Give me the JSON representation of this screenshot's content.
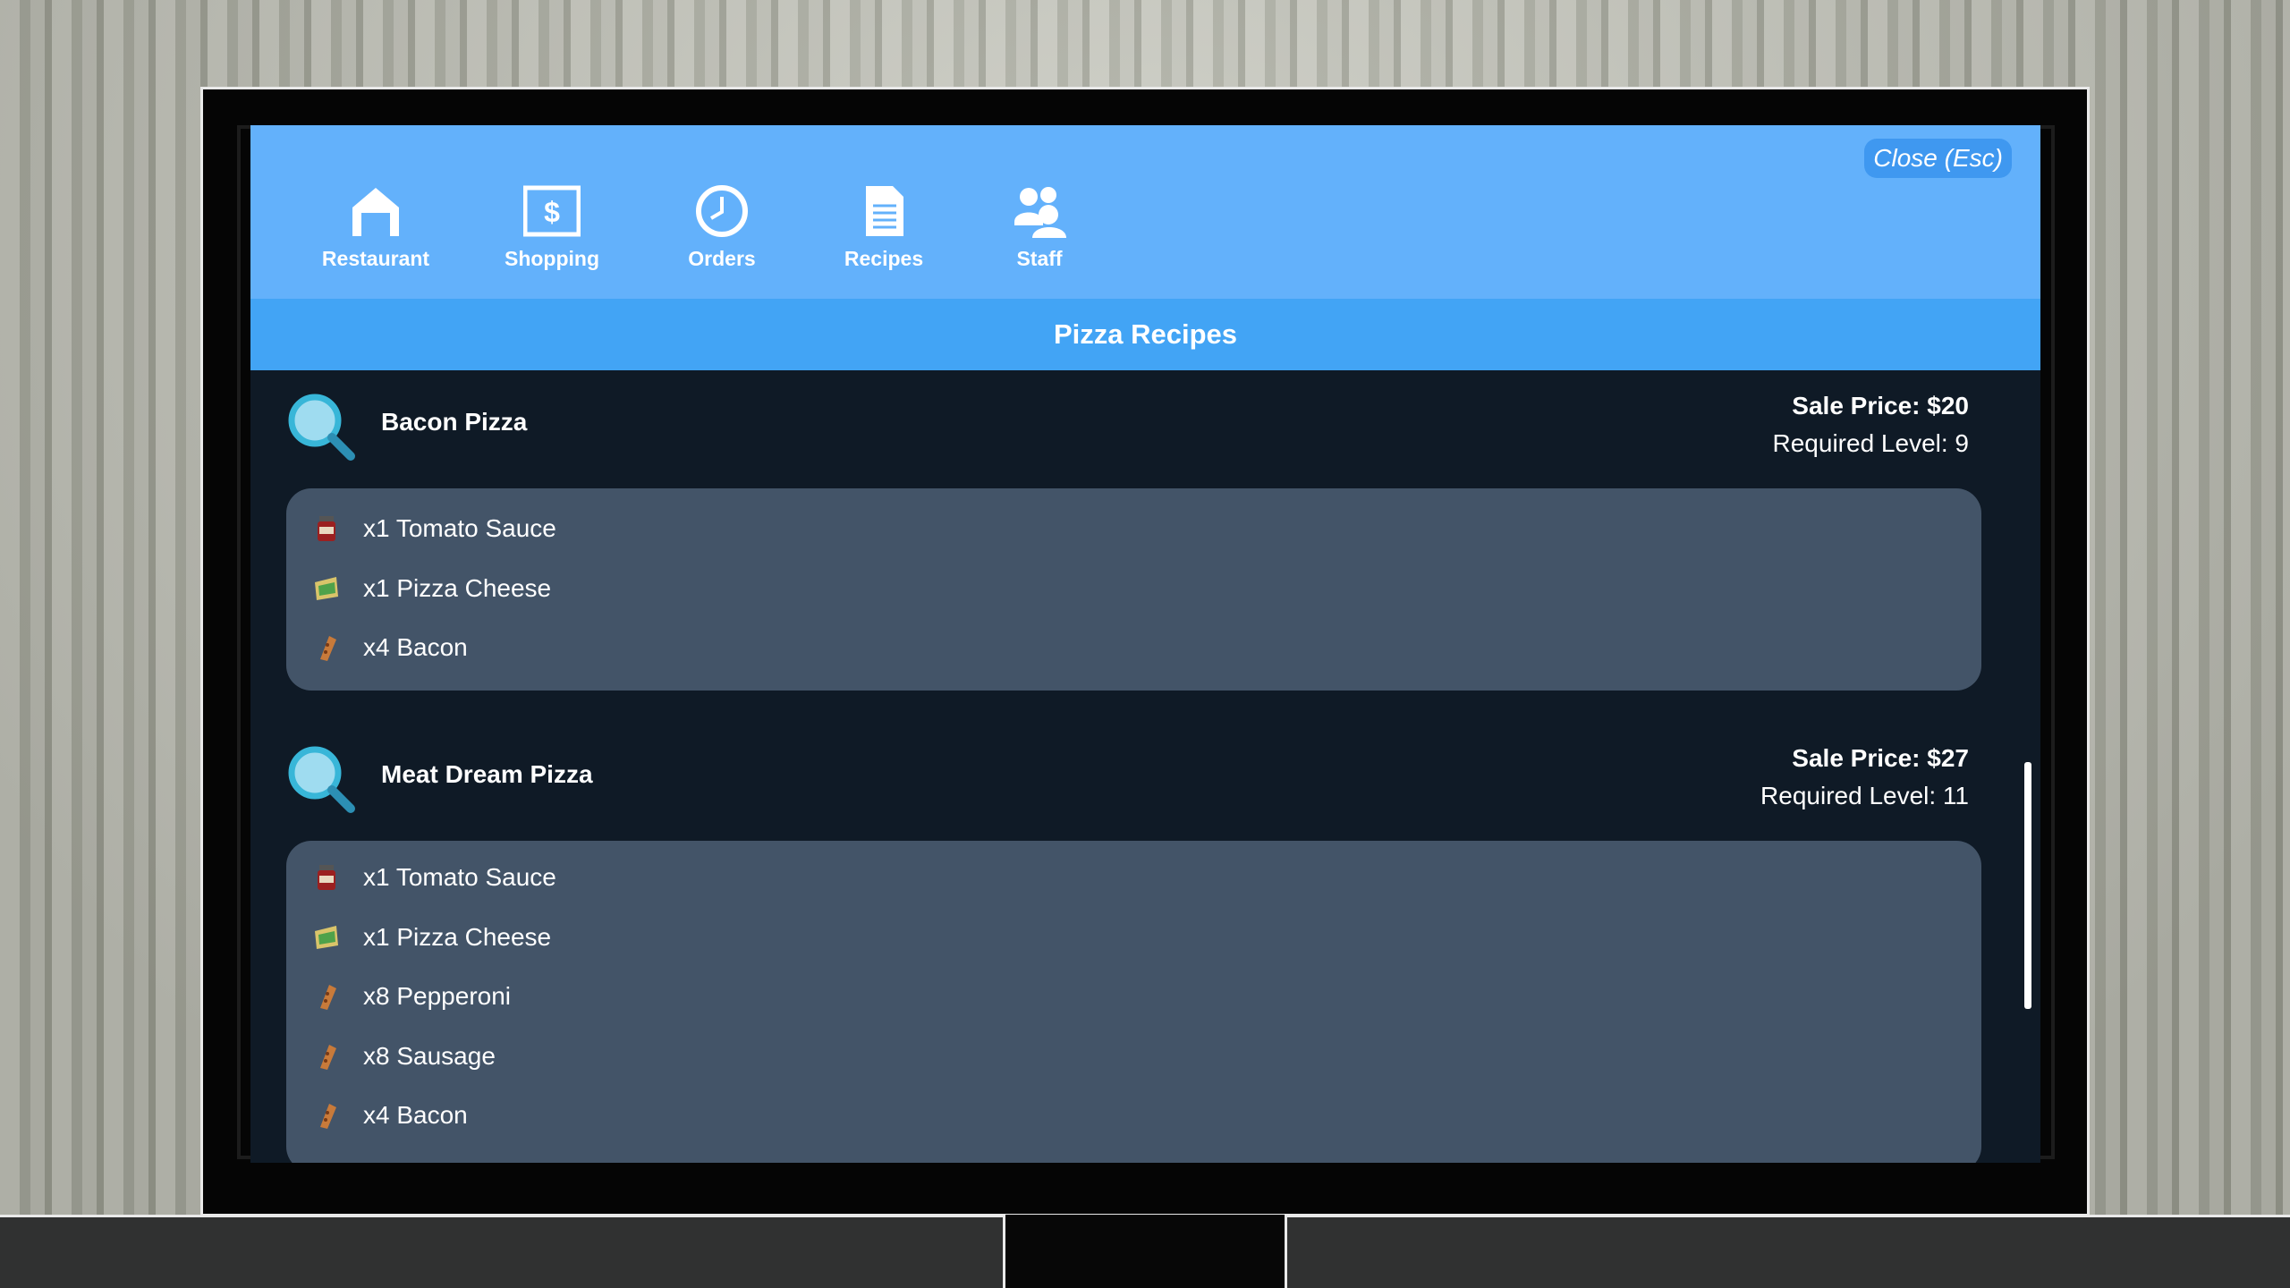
{
  "window": {
    "close_label": "Close (Esc)"
  },
  "nav": {
    "items": [
      {
        "label": "Restaurant",
        "icon": "house-icon"
      },
      {
        "label": "Shopping",
        "icon": "dollar-icon"
      },
      {
        "label": "Orders",
        "icon": "clock-icon"
      },
      {
        "label": "Recipes",
        "icon": "document-icon"
      },
      {
        "label": "Staff",
        "icon": "people-icon"
      }
    ]
  },
  "page": {
    "title": "Pizza Recipes"
  },
  "recipes": [
    {
      "name": "Bacon Pizza",
      "price": "Sale Price: $20",
      "level": "Required Level: 9",
      "ingredients": [
        {
          "text": "x1 Tomato Sauce",
          "icon": "tomato-sauce-icon"
        },
        {
          "text": "x1 Pizza Cheese",
          "icon": "cheese-icon"
        },
        {
          "text": "x4 Bacon",
          "icon": "meat-icon"
        }
      ]
    },
    {
      "name": "Meat Dream Pizza",
      "price": "Sale Price: $27",
      "level": "Required Level: 11",
      "ingredients": [
        {
          "text": "x1 Tomato Sauce",
          "icon": "tomato-sauce-icon"
        },
        {
          "text": "x1 Pizza Cheese",
          "icon": "cheese-icon"
        },
        {
          "text": "x8 Pepperoni",
          "icon": "meat-icon"
        },
        {
          "text": "x8 Sausage",
          "icon": "meat-icon"
        },
        {
          "text": "x4 Bacon",
          "icon": "meat-icon"
        }
      ]
    }
  ],
  "colors": {
    "topbar": "#63b1fb",
    "titlebar": "#42a4f5",
    "panel": "#0f1a26",
    "ingredient_box": "#435468"
  }
}
